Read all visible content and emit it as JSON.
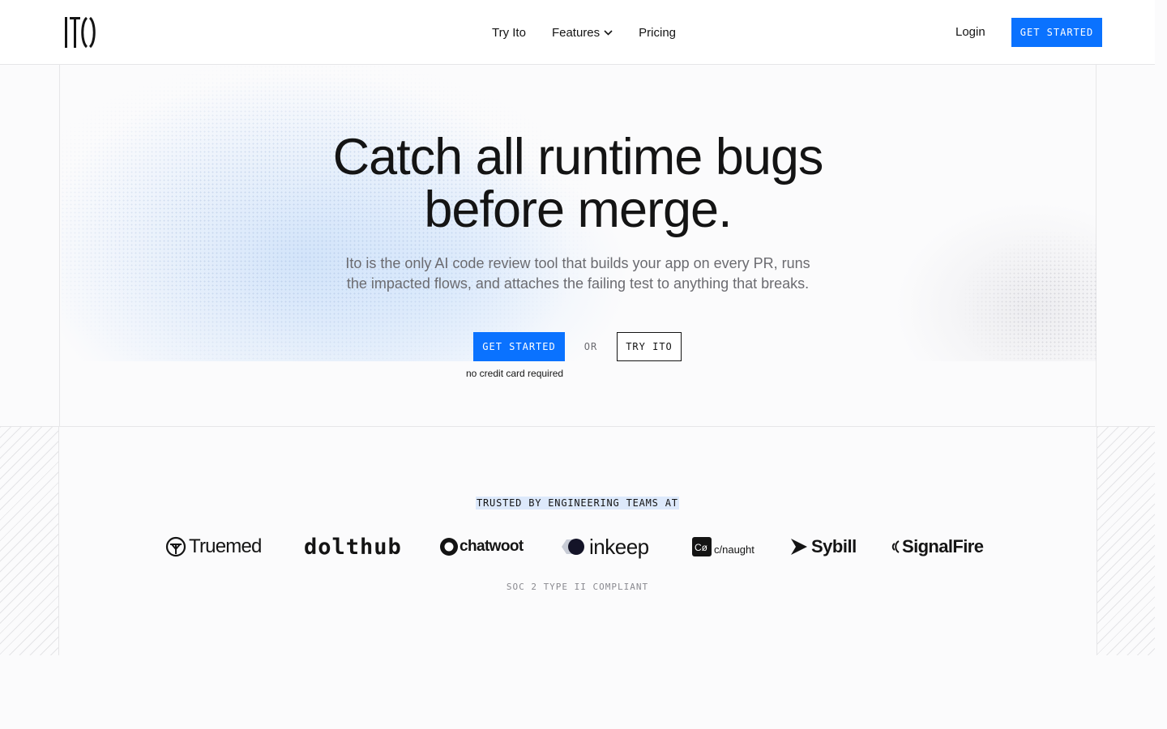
{
  "header": {
    "logo_text": "ITO",
    "nav": [
      {
        "label": "Try Ito"
      },
      {
        "label": "Features",
        "has_dropdown": true
      },
      {
        "label": "Pricing"
      }
    ],
    "login_label": "Login",
    "cta_label": "GET STARTED"
  },
  "hero": {
    "title_line1": "Catch all runtime bugs",
    "title_line2": "before merge.",
    "subtitle_line1": "Ito is the only AI code review tool that builds your app on every PR, runs",
    "subtitle_line2": "the impacted flows, and attaches the failing test to anything that breaks.",
    "primary_cta": "GET STARTED",
    "or_label": "OR",
    "secondary_cta": "TRY ITO",
    "note": "no credit card required"
  },
  "trusted": {
    "label": "TRUSTED BY ENGINEERING TEAMS AT",
    "logos": [
      {
        "name": "Truemed",
        "icon": "truemed-logo-icon"
      },
      {
        "name": "dolthub",
        "icon": "dolthub-logo-icon"
      },
      {
        "name": "chatwoot",
        "icon": "chatwoot-logo-icon"
      },
      {
        "name": "inkeep",
        "icon": "inkeep-logo-icon"
      },
      {
        "name": "c/naught",
        "icon": "conaught-logo-icon"
      },
      {
        "name": "Sybill",
        "icon": "sybill-logo-icon"
      },
      {
        "name": "SignalFire",
        "icon": "signalfire-logo-icon"
      }
    ],
    "compliance": "SOC 2 TYPE II COMPLIANT"
  },
  "colors": {
    "accent": "#0a72ff",
    "text": "#141414",
    "muted": "#6b6b70",
    "highlight": "#dde9fb"
  }
}
